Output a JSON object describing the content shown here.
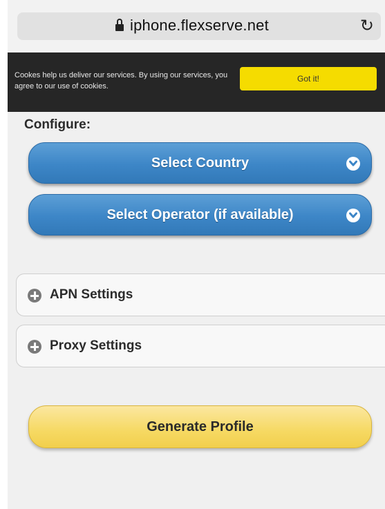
{
  "browser": {
    "url": "iphone.flexserve.net",
    "lock_icon": "lock-icon",
    "reload_icon": "reload-icon",
    "reload_glyph": "↻"
  },
  "cookie_banner": {
    "text": "Cookes help us deliver our services. By using our services, you agree to our use of cookies.",
    "button_label": "Got it!",
    "background": "#262626",
    "button_color": "#f5dc00"
  },
  "main": {
    "heading": "Configure:",
    "select_country_label": "Select Country",
    "select_operator_label": "Select Operator (if available)",
    "dropdown_icon": "chevron-down-icon",
    "sections": [
      {
        "label": "APN Settings",
        "icon": "plus-icon"
      },
      {
        "label": "Proxy Settings",
        "icon": "plus-icon"
      }
    ],
    "generate_label": "Generate Profile"
  },
  "colors": {
    "primary_blue": "#3d86c7",
    "generate_yellow": "#f6d963",
    "page_bg": "#f0f0f0"
  }
}
